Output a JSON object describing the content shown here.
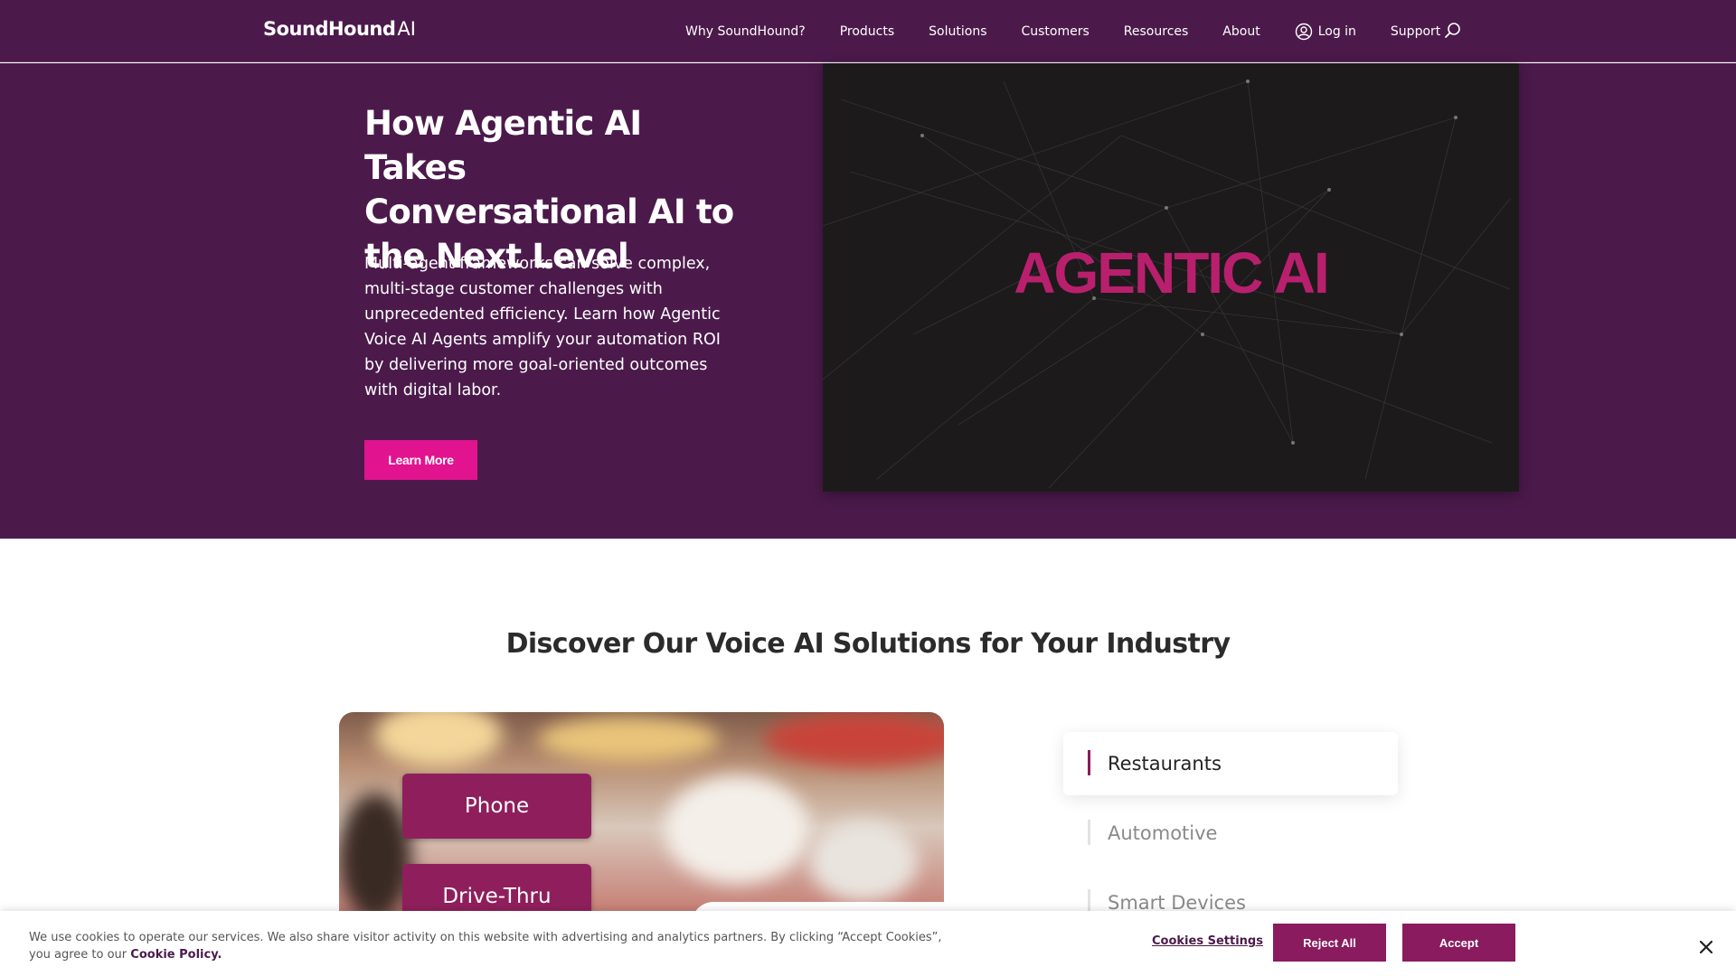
{
  "nav": {
    "logo_main": "SoundHound",
    "logo_suffix": "AI",
    "links": [
      "Why SoundHound?",
      "Products",
      "Solutions",
      "Customers",
      "Resources",
      "About"
    ],
    "login_label": "Log in",
    "support_label": "Support",
    "search_icon": "search-icon",
    "login_icon": "user-circle-icon"
  },
  "hero": {
    "title": "How Agentic AI Takes Conversational AI to the Next Level",
    "description": "Multi-agent frameworks can solve complex, multi-stage customer challenges with unprecedented efficiency. Learn how Agentic Voice AI Agents amplify your automation ROI by delivering more goal-oriented outcomes with digital labor.",
    "button_label": "Learn More",
    "media_text": "AGENTIC AI"
  },
  "section": {
    "title": "Discover Our Voice AI Solutions for Your Industry",
    "image_pills": [
      "Phone",
      "Drive-Thru"
    ],
    "industries": [
      "Restaurants",
      "Automotive",
      "Smart Devices"
    ],
    "active_industry": "Restaurants"
  },
  "cookie": {
    "text": "We use cookies to operate our services. We also share visitor activity on this website with advertising and analytics partners. By clicking “Accept Cookies”, you agree to our",
    "policy_link": "Cookie Policy.",
    "settings_label": "Cookies Settings",
    "reject_label": "Reject All",
    "accept_label": "Accept",
    "close_icon": "close-icon"
  },
  "colors": {
    "nav_bg": "#4b1a4b",
    "accent_pink": "#e2138e",
    "accent_plum": "#8a1b5e",
    "media_text": "#b8206d"
  }
}
